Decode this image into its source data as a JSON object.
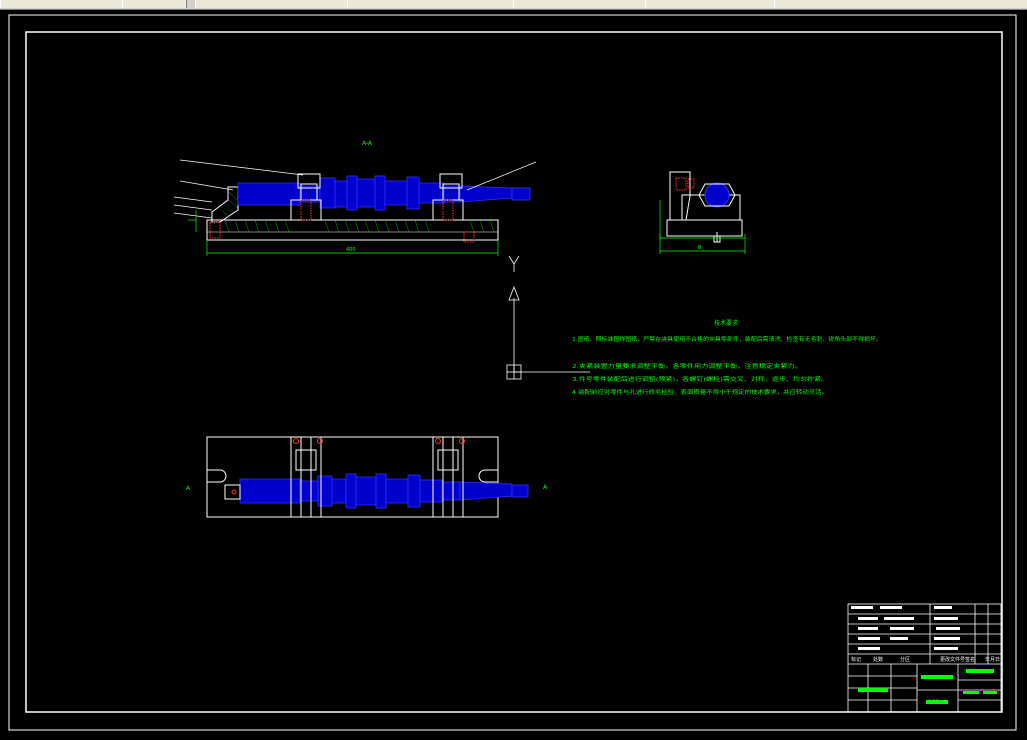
{
  "toolbar": {
    "tabs": [
      "",
      "",
      "",
      "",
      "",
      "",
      ""
    ]
  },
  "drawing": {
    "view_label_top": "A-A",
    "view_label_left": "A",
    "view_label_right": "A",
    "dimension_length": "400",
    "dimension_side": "B",
    "notes": {
      "title": "技术要求",
      "items": [
        "1.图纸、照标准图样图纸，严禁在夹具使用不合格的夹具零部件，装配后需清洗、检查有无毛刺、锐角头部不得损坏。",
        "2.夹紧装置力量要求调整平衡，各零件用力调整平衡，注意稳定夹紧力。",
        "3.件号零件装配后进行调整(预紧)，各螺钉(螺栓)需交叉、对称、逐步、均匀拧紧。",
        "4.装配前应对零件与孔进行修毛检验，表面质量不得小于规定的技术要求，并应转动灵活。"
      ]
    },
    "ucs": {
      "y_label": "Y"
    },
    "title_block": {
      "school": "",
      "drawing_no": "JJ-01",
      "name": "",
      "scale_label": "",
      "sheet_label": "",
      "cols": [
        "标记",
        "处数",
        "分区",
        "更改文件号",
        "签名",
        "年月日"
      ]
    }
  },
  "colors": {
    "background": "#000000",
    "frame": "#ffffff",
    "part": "#0000cc",
    "part_edge": "#4040ff",
    "annotation": "#00ff00",
    "fixture": "#ffffff",
    "hatch": "#00cc00",
    "red_mark": "#ff3030"
  }
}
